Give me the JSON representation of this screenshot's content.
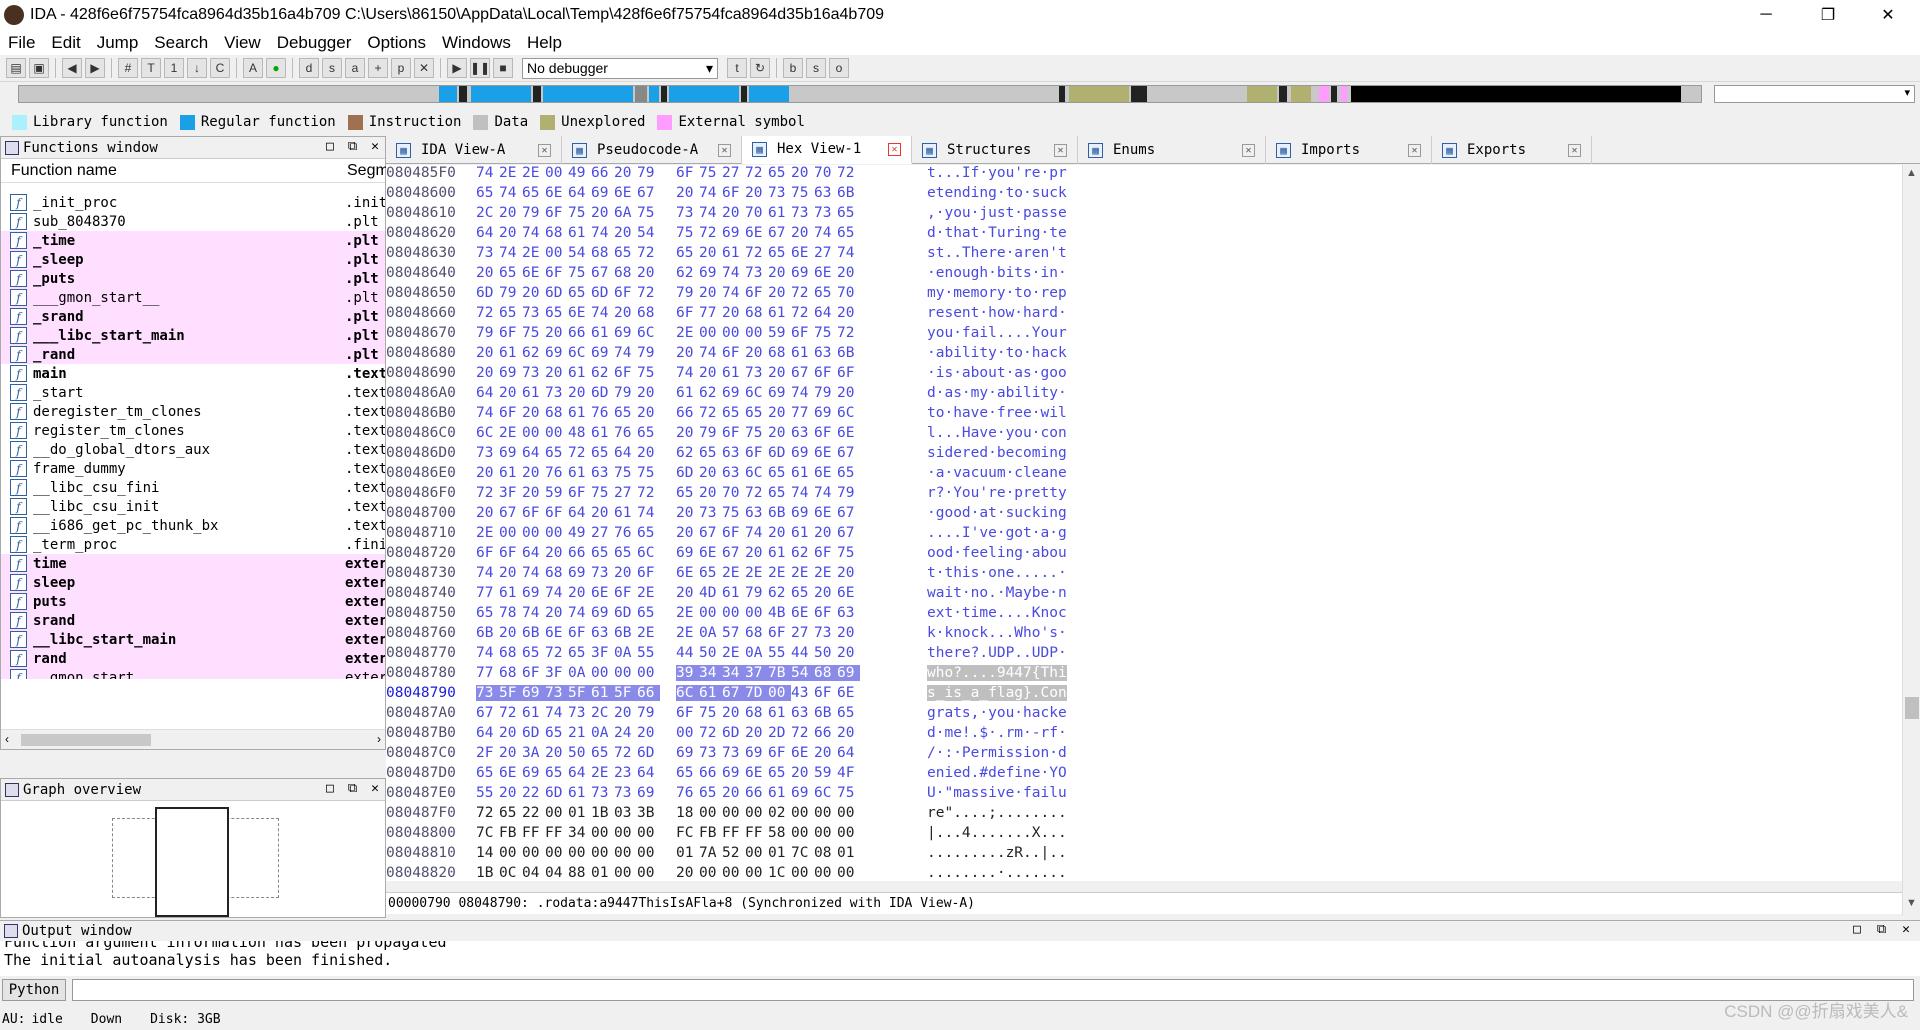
{
  "window": {
    "title": "IDA - 428f6e6f75754fca8964d35b16a4b709 C:\\Users\\86150\\AppData\\Local\\Temp\\428f6e6f75754fca8964d35b16a4b709",
    "minimize": "─",
    "maximize": "❐",
    "close": "✕"
  },
  "menu": [
    "File",
    "Edit",
    "Jump",
    "Search",
    "View",
    "Debugger",
    "Options",
    "Windows",
    "Help"
  ],
  "toolbar": {
    "debugger_select": "No debugger"
  },
  "legend": [
    {
      "label": "Library function",
      "color": "#aaf0ff"
    },
    {
      "label": "Regular function",
      "color": "#1ba0e8"
    },
    {
      "label": "Instruction",
      "color": "#a07050"
    },
    {
      "label": "Data",
      "color": "#c0c0c0"
    },
    {
      "label": "Unexplored",
      "color": "#b0b070"
    },
    {
      "label": "External symbol",
      "color": "#ff9cff"
    }
  ],
  "functions_window": {
    "title": "Functions window",
    "col_name": "Function name",
    "col_segment": "Segm",
    "rows": [
      {
        "name": "_init_proc",
        "seg": ".init",
        "pink": false,
        "bold": false
      },
      {
        "name": "sub_8048370",
        "seg": ".plt",
        "pink": false,
        "bold": false
      },
      {
        "name": "_time",
        "seg": ".plt",
        "pink": true,
        "bold": true
      },
      {
        "name": "_sleep",
        "seg": ".plt",
        "pink": true,
        "bold": true
      },
      {
        "name": "_puts",
        "seg": ".plt",
        "pink": true,
        "bold": true
      },
      {
        "name": "___gmon_start__",
        "seg": ".plt",
        "pink": true,
        "bold": false
      },
      {
        "name": "_srand",
        "seg": ".plt",
        "pink": true,
        "bold": true
      },
      {
        "name": "___libc_start_main",
        "seg": ".plt",
        "pink": true,
        "bold": true
      },
      {
        "name": "_rand",
        "seg": ".plt",
        "pink": true,
        "bold": true
      },
      {
        "name": "main",
        "seg": ".text",
        "pink": false,
        "bold": true
      },
      {
        "name": "_start",
        "seg": ".text",
        "pink": false,
        "bold": false
      },
      {
        "name": "deregister_tm_clones",
        "seg": ".text",
        "pink": false,
        "bold": false
      },
      {
        "name": "register_tm_clones",
        "seg": ".text",
        "pink": false,
        "bold": false
      },
      {
        "name": "__do_global_dtors_aux",
        "seg": ".text",
        "pink": false,
        "bold": false
      },
      {
        "name": "frame_dummy",
        "seg": ".text",
        "pink": false,
        "bold": false
      },
      {
        "name": "__libc_csu_fini",
        "seg": ".text",
        "pink": false,
        "bold": false
      },
      {
        "name": "__libc_csu_init",
        "seg": ".text",
        "pink": false,
        "bold": false
      },
      {
        "name": "__i686_get_pc_thunk_bx",
        "seg": ".text",
        "pink": false,
        "bold": false
      },
      {
        "name": "_term_proc",
        "seg": ".fini",
        "pink": false,
        "bold": false
      },
      {
        "name": "time",
        "seg": "extern",
        "pink": true,
        "bold": true
      },
      {
        "name": "sleep",
        "seg": "extern",
        "pink": true,
        "bold": true
      },
      {
        "name": "puts",
        "seg": "extern",
        "pink": true,
        "bold": true
      },
      {
        "name": "srand",
        "seg": "extern",
        "pink": true,
        "bold": true
      },
      {
        "name": "__libc_start_main",
        "seg": "extern",
        "pink": true,
        "bold": true
      },
      {
        "name": "rand",
        "seg": "extern",
        "pink": true,
        "bold": true
      },
      {
        "name": "__gmon_start__",
        "seg": "extern",
        "pink": true,
        "bold": false
      }
    ]
  },
  "graph_overview": {
    "title": "Graph overview"
  },
  "tabs": [
    {
      "label": "IDA View-A",
      "icon": "ida-view-icon",
      "active": false
    },
    {
      "label": "Pseudocode-A",
      "icon": "pseudocode-icon",
      "active": false
    },
    {
      "label": "Hex View-1",
      "icon": "hex-view-icon",
      "active": true
    },
    {
      "label": "Structures",
      "icon": "structures-icon",
      "active": false
    },
    {
      "label": "Enums",
      "icon": "enums-icon",
      "active": false
    },
    {
      "label": "Imports",
      "icon": "imports-icon",
      "active": false
    },
    {
      "label": "Exports",
      "icon": "exports-icon",
      "active": false
    }
  ],
  "hex_rows": [
    {
      "addr": "080485F0",
      "bytes": [
        "74",
        "2E",
        "2E",
        "00",
        "49",
        "66",
        "20",
        "79",
        "6F",
        "75",
        "27",
        "72",
        "65",
        "20",
        "70",
        "72"
      ],
      "ascii": "t...If·you're·pr"
    },
    {
      "addr": "08048600",
      "bytes": [
        "65",
        "74",
        "65",
        "6E",
        "64",
        "69",
        "6E",
        "67",
        "20",
        "74",
        "6F",
        "20",
        "73",
        "75",
        "63",
        "6B"
      ],
      "ascii": "etending·to·suck"
    },
    {
      "addr": "08048610",
      "bytes": [
        "2C",
        "20",
        "79",
        "6F",
        "75",
        "20",
        "6A",
        "75",
        "73",
        "74",
        "20",
        "70",
        "61",
        "73",
        "73",
        "65"
      ],
      "ascii": ",·you·just·passe"
    },
    {
      "addr": "08048620",
      "bytes": [
        "64",
        "20",
        "74",
        "68",
        "61",
        "74",
        "20",
        "54",
        "75",
        "72",
        "69",
        "6E",
        "67",
        "20",
        "74",
        "65"
      ],
      "ascii": "d·that·Turing·te"
    },
    {
      "addr": "08048630",
      "bytes": [
        "73",
        "74",
        "2E",
        "00",
        "54",
        "68",
        "65",
        "72",
        "65",
        "20",
        "61",
        "72",
        "65",
        "6E",
        "27",
        "74"
      ],
      "ascii": "st..There·aren't"
    },
    {
      "addr": "08048640",
      "bytes": [
        "20",
        "65",
        "6E",
        "6F",
        "75",
        "67",
        "68",
        "20",
        "62",
        "69",
        "74",
        "73",
        "20",
        "69",
        "6E",
        "20"
      ],
      "ascii": "·enough·bits·in·"
    },
    {
      "addr": "08048650",
      "bytes": [
        "6D",
        "79",
        "20",
        "6D",
        "65",
        "6D",
        "6F",
        "72",
        "79",
        "20",
        "74",
        "6F",
        "20",
        "72",
        "65",
        "70"
      ],
      "ascii": "my·memory·to·rep"
    },
    {
      "addr": "08048660",
      "bytes": [
        "72",
        "65",
        "73",
        "65",
        "6E",
        "74",
        "20",
        "68",
        "6F",
        "77",
        "20",
        "68",
        "61",
        "72",
        "64",
        "20"
      ],
      "ascii": "resent·how·hard·"
    },
    {
      "addr": "08048670",
      "bytes": [
        "79",
        "6F",
        "75",
        "20",
        "66",
        "61",
        "69",
        "6C",
        "2E",
        "00",
        "00",
        "00",
        "59",
        "6F",
        "75",
        "72"
      ],
      "ascii": "you·fail....Your"
    },
    {
      "addr": "08048680",
      "bytes": [
        "20",
        "61",
        "62",
        "69",
        "6C",
        "69",
        "74",
        "79",
        "20",
        "74",
        "6F",
        "20",
        "68",
        "61",
        "63",
        "6B"
      ],
      "ascii": "·ability·to·hack"
    },
    {
      "addr": "08048690",
      "bytes": [
        "20",
        "69",
        "73",
        "20",
        "61",
        "62",
        "6F",
        "75",
        "74",
        "20",
        "61",
        "73",
        "20",
        "67",
        "6F",
        "6F"
      ],
      "ascii": "·is·about·as·goo"
    },
    {
      "addr": "080486A0",
      "bytes": [
        "64",
        "20",
        "61",
        "73",
        "20",
        "6D",
        "79",
        "20",
        "61",
        "62",
        "69",
        "6C",
        "69",
        "74",
        "79",
        "20"
      ],
      "ascii": "d·as·my·ability·"
    },
    {
      "addr": "080486B0",
      "bytes": [
        "74",
        "6F",
        "20",
        "68",
        "61",
        "76",
        "65",
        "20",
        "66",
        "72",
        "65",
        "65",
        "20",
        "77",
        "69",
        "6C"
      ],
      "ascii": "to·have·free·wil"
    },
    {
      "addr": "080486C0",
      "bytes": [
        "6C",
        "2E",
        "00",
        "00",
        "48",
        "61",
        "76",
        "65",
        "20",
        "79",
        "6F",
        "75",
        "20",
        "63",
        "6F",
        "6E"
      ],
      "ascii": "l...Have·you·con"
    },
    {
      "addr": "080486D0",
      "bytes": [
        "73",
        "69",
        "64",
        "65",
        "72",
        "65",
        "64",
        "20",
        "62",
        "65",
        "63",
        "6F",
        "6D",
        "69",
        "6E",
        "67"
      ],
      "ascii": "sidered·becoming"
    },
    {
      "addr": "080486E0",
      "bytes": [
        "20",
        "61",
        "20",
        "76",
        "61",
        "63",
        "75",
        "75",
        "6D",
        "20",
        "63",
        "6C",
        "65",
        "61",
        "6E",
        "65"
      ],
      "ascii": "·a·vacuum·cleane"
    },
    {
      "addr": "080486F0",
      "bytes": [
        "72",
        "3F",
        "20",
        "59",
        "6F",
        "75",
        "27",
        "72",
        "65",
        "20",
        "70",
        "72",
        "65",
        "74",
        "74",
        "79"
      ],
      "ascii": "r?·You're·pretty"
    },
    {
      "addr": "08048700",
      "bytes": [
        "20",
        "67",
        "6F",
        "6F",
        "64",
        "20",
        "61",
        "74",
        "20",
        "73",
        "75",
        "63",
        "6B",
        "69",
        "6E",
        "67"
      ],
      "ascii": "·good·at·sucking"
    },
    {
      "addr": "08048710",
      "bytes": [
        "2E",
        "00",
        "00",
        "00",
        "49",
        "27",
        "76",
        "65",
        "20",
        "67",
        "6F",
        "74",
        "20",
        "61",
        "20",
        "67"
      ],
      "ascii": "....I've·got·a·g"
    },
    {
      "addr": "08048720",
      "bytes": [
        "6F",
        "6F",
        "64",
        "20",
        "66",
        "65",
        "65",
        "6C",
        "69",
        "6E",
        "67",
        "20",
        "61",
        "62",
        "6F",
        "75"
      ],
      "ascii": "ood·feeling·abou"
    },
    {
      "addr": "08048730",
      "bytes": [
        "74",
        "20",
        "74",
        "68",
        "69",
        "73",
        "20",
        "6F",
        "6E",
        "65",
        "2E",
        "2E",
        "2E",
        "2E",
        "2E",
        "20"
      ],
      "ascii": "t·this·one.....·"
    },
    {
      "addr": "08048740",
      "bytes": [
        "77",
        "61",
        "69",
        "74",
        "20",
        "6E",
        "6F",
        "2E",
        "20",
        "4D",
        "61",
        "79",
        "62",
        "65",
        "20",
        "6E"
      ],
      "ascii": "wait·no.·Maybe·n"
    },
    {
      "addr": "08048750",
      "bytes": [
        "65",
        "78",
        "74",
        "20",
        "74",
        "69",
        "6D",
        "65",
        "2E",
        "00",
        "00",
        "00",
        "4B",
        "6E",
        "6F",
        "63"
      ],
      "ascii": "ext·time....Knoc"
    },
    {
      "addr": "08048760",
      "bytes": [
        "6B",
        "20",
        "6B",
        "6E",
        "6F",
        "63",
        "6B",
        "2E",
        "2E",
        "0A",
        "57",
        "68",
        "6F",
        "27",
        "73",
        "20"
      ],
      "ascii": "k·knock...Who's·"
    },
    {
      "addr": "08048770",
      "bytes": [
        "74",
        "68",
        "65",
        "72",
        "65",
        "3F",
        "0A",
        "55",
        "44",
        "50",
        "2E",
        "0A",
        "55",
        "44",
        "50",
        "20"
      ],
      "ascii": "there?.UDP..UDP·"
    },
    {
      "addr": "08048780",
      "bytes": [
        "77",
        "68",
        "6F",
        "3F",
        "0A",
        "00",
        "00",
        "00",
        "39",
        "34",
        "34",
        "37",
        "7B",
        "54",
        "68",
        "69"
      ],
      "ascii": "who?....9447{Thi"
    },
    {
      "addr": "08048790",
      "bytes": [
        "73",
        "5F",
        "69",
        "73",
        "5F",
        "61",
        "5F",
        "66",
        "6C",
        "61",
        "67",
        "7D",
        "00",
        "43",
        "6F",
        "6E"
      ],
      "ascii": "s_is_a_flag}.Con"
    },
    {
      "addr": "080487A0",
      "bytes": [
        "67",
        "72",
        "61",
        "74",
        "73",
        "2C",
        "20",
        "79",
        "6F",
        "75",
        "20",
        "68",
        "61",
        "63",
        "6B",
        "65"
      ],
      "ascii": "grats,·you·hacke"
    },
    {
      "addr": "080487B0",
      "bytes": [
        "64",
        "20",
        "6D",
        "65",
        "21",
        "0A",
        "24",
        "20",
        "00",
        "72",
        "6D",
        "20",
        "2D",
        "72",
        "66",
        "20"
      ],
      "ascii": "d·me!.$·.rm·-rf·"
    },
    {
      "addr": "080487C0",
      "bytes": [
        "2F",
        "20",
        "3A",
        "20",
        "50",
        "65",
        "72",
        "6D",
        "69",
        "73",
        "73",
        "69",
        "6F",
        "6E",
        "20",
        "64"
      ],
      "ascii": "/·:·Permission·d"
    },
    {
      "addr": "080487D0",
      "bytes": [
        "65",
        "6E",
        "69",
        "65",
        "64",
        "2E",
        "23",
        "64",
        "65",
        "66",
        "69",
        "6E",
        "65",
        "20",
        "59",
        "4F"
      ],
      "ascii": "enied.#define·YO"
    },
    {
      "addr": "080487E0",
      "bytes": [
        "55",
        "20",
        "22",
        "6D",
        "61",
        "73",
        "73",
        "69",
        "76",
        "65",
        "20",
        "66",
        "61",
        "69",
        "6C",
        "75"
      ],
      "ascii": "U·\"massive·failu"
    },
    {
      "addr": "080487F0",
      "bytes": [
        "72",
        "65",
        "22",
        "00",
        "01",
        "1B",
        "03",
        "3B",
        "18",
        "00",
        "00",
        "00",
        "02",
        "00",
        "00",
        "00"
      ],
      "ascii": "re\"....;........"
    },
    {
      "addr": "08048800",
      "bytes": [
        "7C",
        "FB",
        "FF",
        "FF",
        "34",
        "00",
        "00",
        "00",
        "FC",
        "FB",
        "FF",
        "FF",
        "58",
        "00",
        "00",
        "00"
      ],
      "ascii": "|...4.......X..."
    },
    {
      "addr": "08048810",
      "bytes": [
        "14",
        "00",
        "00",
        "00",
        "00",
        "00",
        "00",
        "00",
        "01",
        "7A",
        "52",
        "00",
        "01",
        "7C",
        "08",
        "01"
      ],
      "ascii": ".........zR..|.."
    },
    {
      "addr": "08048820",
      "bytes": [
        "1B",
        "0C",
        "04",
        "04",
        "88",
        "01",
        "00",
        "00",
        "20",
        "00",
        "00",
        "00",
        "1C",
        "00",
        "00",
        "00"
      ],
      "ascii": "........·......."
    }
  ],
  "hex_status": "00000790 08048790: .rodata:a9447ThisIsAFla+8 (Synchronized with IDA View-A)",
  "output_window": {
    "title": "Output window",
    "lines": [
      "Function argument information has been propagated",
      "The initial autoanalysis has been finished."
    ]
  },
  "python_button": "Python",
  "statusbar": {
    "au": "AU:",
    "state": "idle",
    "direction": "Down",
    "disk": "Disk: 3GB"
  },
  "watermark": "CSDN @@折扇戏美人&"
}
